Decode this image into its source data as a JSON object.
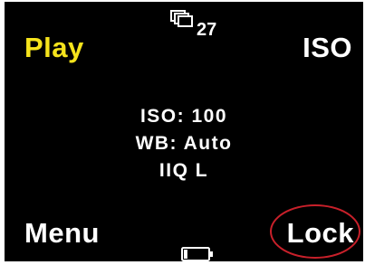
{
  "colors": {
    "screen_bg": "#000000",
    "play_label": "#f5e31c",
    "text": "#ffffff",
    "highlight_ring": "#c8202a"
  },
  "softkeys": {
    "top_left": "Play",
    "top_right": "ISO",
    "bottom_left": "Menu",
    "bottom_right": "Lock"
  },
  "status": {
    "shots_icon": "stacked-frames-icon",
    "shots_remaining": "27",
    "battery_icon": "battery-icon",
    "battery_level": 0.15
  },
  "settings": {
    "iso": "ISO: 100",
    "white_balance": "WB: Auto",
    "file_format": "IIQ L"
  },
  "annotation": {
    "highlighted": "bottom_right"
  }
}
